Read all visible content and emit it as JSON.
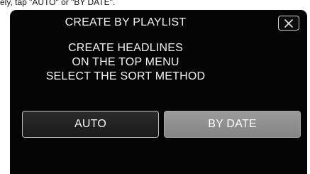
{
  "caption": "ely, tap \"AUTO\" or \"BY DATE\".",
  "dialog": {
    "title": "CREATE BY PLAYLIST",
    "close_icon": "close-icon",
    "message_lines": [
      "CREATE HEADLINES",
      "ON THE TOP MENU",
      "SELECT THE SORT METHOD"
    ],
    "buttons": {
      "auto_label": "AUTO",
      "by_date_label": "BY DATE"
    }
  },
  "colors": {
    "screen_background": "#050505",
    "text": "#f2f2f2",
    "selected_button": "#8f8f8f"
  }
}
